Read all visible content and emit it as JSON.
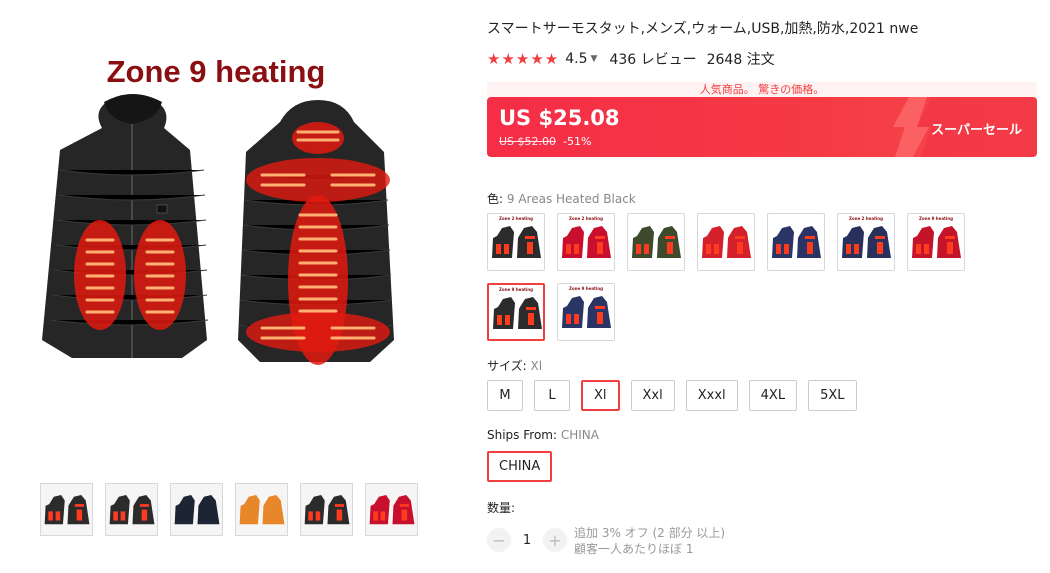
{
  "gallery": {
    "main_title": "Zone 9 heating",
    "thumbnails": [
      {
        "icon": "jacket-pair-heating-thumb"
      },
      {
        "icon": "jacket-back-heating-thumb"
      },
      {
        "icon": "jacket-battery-thumb"
      },
      {
        "icon": "jacket-orange-glow-thumb"
      },
      {
        "icon": "jacket-heating-pads-thumb"
      },
      {
        "icon": "jacket-size-chart-thumb"
      }
    ]
  },
  "product": {
    "title": "スマートサーモスタット,メンズ,ウォーム,USB,加熱,防水,2021 nwe",
    "stars": "★★★★★",
    "rating": "4.5",
    "reviews": "436 レビュー",
    "orders": "2648 注文"
  },
  "promo": {
    "tagline": "人気商品。 驚きの価格。",
    "price": "US $25.08",
    "original_price": "US $52.00",
    "discount": "-51%",
    "sale_label": "スーパーセール",
    "accent_color": "#f23e3e"
  },
  "color": {
    "label": "色:",
    "value": "9 Areas Heated Black",
    "swatches": [
      {
        "name": "black-2-zone",
        "jacket": "#2b2b2b",
        "caption": "Zone 2 heating"
      },
      {
        "name": "red-2-zone",
        "jacket": "#c8102e",
        "caption": "Zone 2 heating"
      },
      {
        "name": "army-green",
        "jacket": "#3d4a2c",
        "caption": ""
      },
      {
        "name": "red-puffer",
        "jacket": "#d3202a",
        "caption": ""
      },
      {
        "name": "navy-heated",
        "jacket": "#2a3566",
        "caption": ""
      },
      {
        "name": "navy-2-zone",
        "jacket": "#28305c",
        "caption": "Zone 2 heating"
      },
      {
        "name": "red-9-zone",
        "jacket": "#c4142a",
        "caption": "Zone 9 heating"
      },
      {
        "name": "black-9-zone",
        "jacket": "#2b2b2b",
        "caption": "Zone 9 heating",
        "selected": true
      },
      {
        "name": "navy-9-zone",
        "jacket": "#2a3566",
        "caption": "Zone 9 heating"
      }
    ]
  },
  "size": {
    "label": "サイズ:",
    "value": "Xl",
    "options": [
      "M",
      "L",
      "Xl",
      "Xxl",
      "Xxxl",
      "4XL",
      "5XL"
    ],
    "selected": "Xl"
  },
  "ships": {
    "label": "Ships From:",
    "value": "CHINA",
    "option": "CHINA"
  },
  "quantity": {
    "label": "数量:",
    "minus": "−",
    "value": "1",
    "plus": "+",
    "note_line1": "追加 3% オフ (2 部分 以上)",
    "note_line2": "顧客一人あたりほぼ 1"
  }
}
